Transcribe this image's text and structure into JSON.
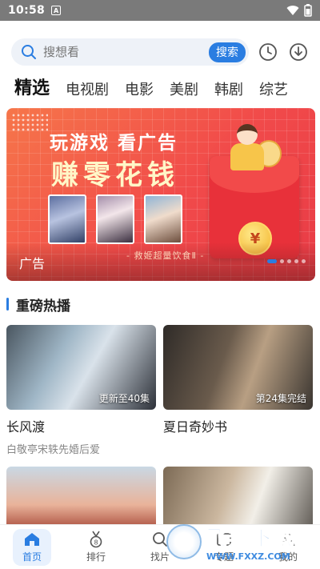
{
  "status_bar": {
    "time": "10:58",
    "notification_badge": "A"
  },
  "search": {
    "placeholder": "搜想看",
    "button_label": "搜索"
  },
  "tabs": [
    {
      "label": "精选",
      "active": true
    },
    {
      "label": "电视剧"
    },
    {
      "label": "电影"
    },
    {
      "label": "美剧"
    },
    {
      "label": "韩剧"
    },
    {
      "label": "综艺"
    }
  ],
  "banner": {
    "headline": "玩游戏 看广告",
    "tagline": "赚零花钱",
    "label": "广告",
    "subtext": "- 救姬超量饮食Ⅱ -",
    "coin_symbol": "¥",
    "page_count": 5,
    "active_page": 1
  },
  "section": {
    "title": "重磅热播"
  },
  "cards": [
    {
      "title": "长风渡",
      "subtitle": "白敬亭宋轶先婚后爱",
      "badge": "更新至40集"
    },
    {
      "title": "夏日奇妙书",
      "subtitle": "",
      "badge": "第24集完结"
    },
    {
      "title": "",
      "subtitle": "",
      "badge": ""
    },
    {
      "title": "",
      "subtitle": "",
      "badge": ""
    }
  ],
  "bottom_nav": [
    {
      "label": "首页",
      "icon": "home-icon",
      "active": true
    },
    {
      "label": "排行",
      "icon": "ranking-medal-icon"
    },
    {
      "label": "找片",
      "icon": "search-icon"
    },
    {
      "label": "专题",
      "icon": "topic-icon"
    },
    {
      "label": "我的",
      "icon": "user-icon"
    }
  ],
  "watermark": {
    "big": "飞翔下载",
    "small": "WWW.FXXZ.COM"
  },
  "colors": {
    "accent": "#2a7de1",
    "banner_red": "#f14a4a",
    "status_bar": "#7a7a7a"
  }
}
